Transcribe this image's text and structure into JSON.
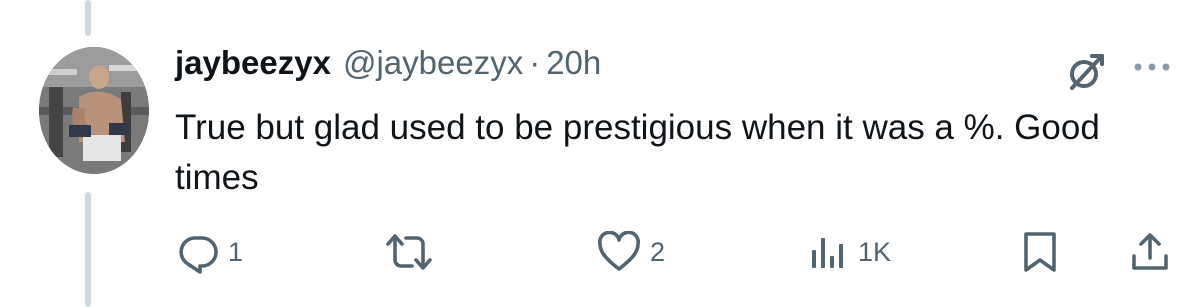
{
  "tweet": {
    "display_name": "jaybeezyx",
    "handle": "@jaybeezyx",
    "separator": "·",
    "timestamp": "20h",
    "text": "True but glad used to be prestigious when it was a %. Good times"
  },
  "actions": {
    "reply_count": "1",
    "retweet_count": "",
    "like_count": "2",
    "views_count": "1K"
  },
  "icons": {
    "grok": "grok-icon",
    "more": "more-icon",
    "reply": "reply-icon",
    "retweet": "retweet-icon",
    "like": "heart-icon",
    "views": "views-icon",
    "bookmark": "bookmark-icon",
    "share": "share-icon"
  },
  "colors": {
    "text_primary": "#0f1419",
    "text_secondary": "#536471",
    "thread_line": "#cfd9de",
    "background": "#ffffff"
  }
}
